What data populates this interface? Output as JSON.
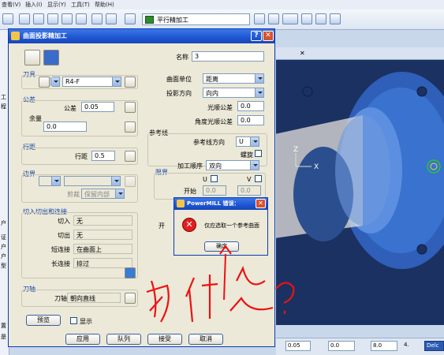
{
  "menubar": {
    "items": [
      "查看(V)",
      "插入(I)",
      "显示(Y)",
      "工具(T)",
      "帮助(H)"
    ]
  },
  "toolbar": {
    "strategy_combo": "平行精加工"
  },
  "leftstrip": {
    "chars": [
      "工",
      "程",
      "",
      "户",
      "",
      "证",
      "户",
      "户",
      "型",
      "",
      "",
      "",
      "置",
      "",
      "是"
    ]
  },
  "dialog": {
    "title": "曲面投影精加工",
    "help_btn": "?",
    "close_btn": "✕",
    "name_label": "名称",
    "name_value": "3",
    "tool_group": "刀具",
    "tool_value": "R4-F",
    "tolerance_group": "公差",
    "tolerance_label": "公差",
    "tolerance_value": "0.05",
    "allowance_group": "余量",
    "allowance_value": "0.0",
    "stepover_group": "行距",
    "stepover_label": "行距",
    "stepover_value": "0.5",
    "boundary_group": "边界",
    "clip_label": "剪裁",
    "clip_value": "保留内部",
    "leads_group": "切入切出和连接",
    "lead_in_label": "切入",
    "lead_in_value": "无",
    "lead_out_label": "切出",
    "lead_out_value": "无",
    "short_link_label": "短连接",
    "short_link_value": "在曲面上",
    "long_link_label": "长连接",
    "long_link_value": "掠过",
    "axis_group": "刀轴",
    "axis_label": "刀轴",
    "axis_value": "朝向直线",
    "preview_btn": "预览",
    "display_label": "显示",
    "surface_units_label": "曲面单位",
    "surface_units_value": "距离",
    "projection_dir_label": "投影方向",
    "projection_dir_value": "向内",
    "smoothing_tol_label": "光顺公差",
    "smoothing_tol_value": "0.0",
    "angular_smoothing_label": "角度光顺公差",
    "angular_smoothing_value": "0.0",
    "reference_group": "参考线",
    "ref_dir_label": "参考线方向",
    "ref_dir_value": "U",
    "spiral_label": "螺旋",
    "order_label": "加工顺序",
    "order_value": "双向",
    "limits_group": "限界",
    "u_label": "U",
    "v_label": "V",
    "start_label": "开始",
    "start_u": "0.0",
    "start_v": "0.0",
    "partial_label": "开",
    "apply_btn": "应用",
    "queue_btn": "队列",
    "accept_btn": "接受",
    "cancel_btn": "取消"
  },
  "error_box": {
    "title": "PowerMILL 错误：",
    "message": "仅应选取一个参考曲面",
    "ok_btn": "确定"
  },
  "annotation": {
    "text": "为什么?"
  },
  "viewport": {
    "axis_z": "Z",
    "axis_x": "X"
  },
  "statusbar": {
    "v1": "0.05",
    "v2": "0.0",
    "v3": "8.0",
    "v4": "4.",
    "del": "Delc"
  }
}
